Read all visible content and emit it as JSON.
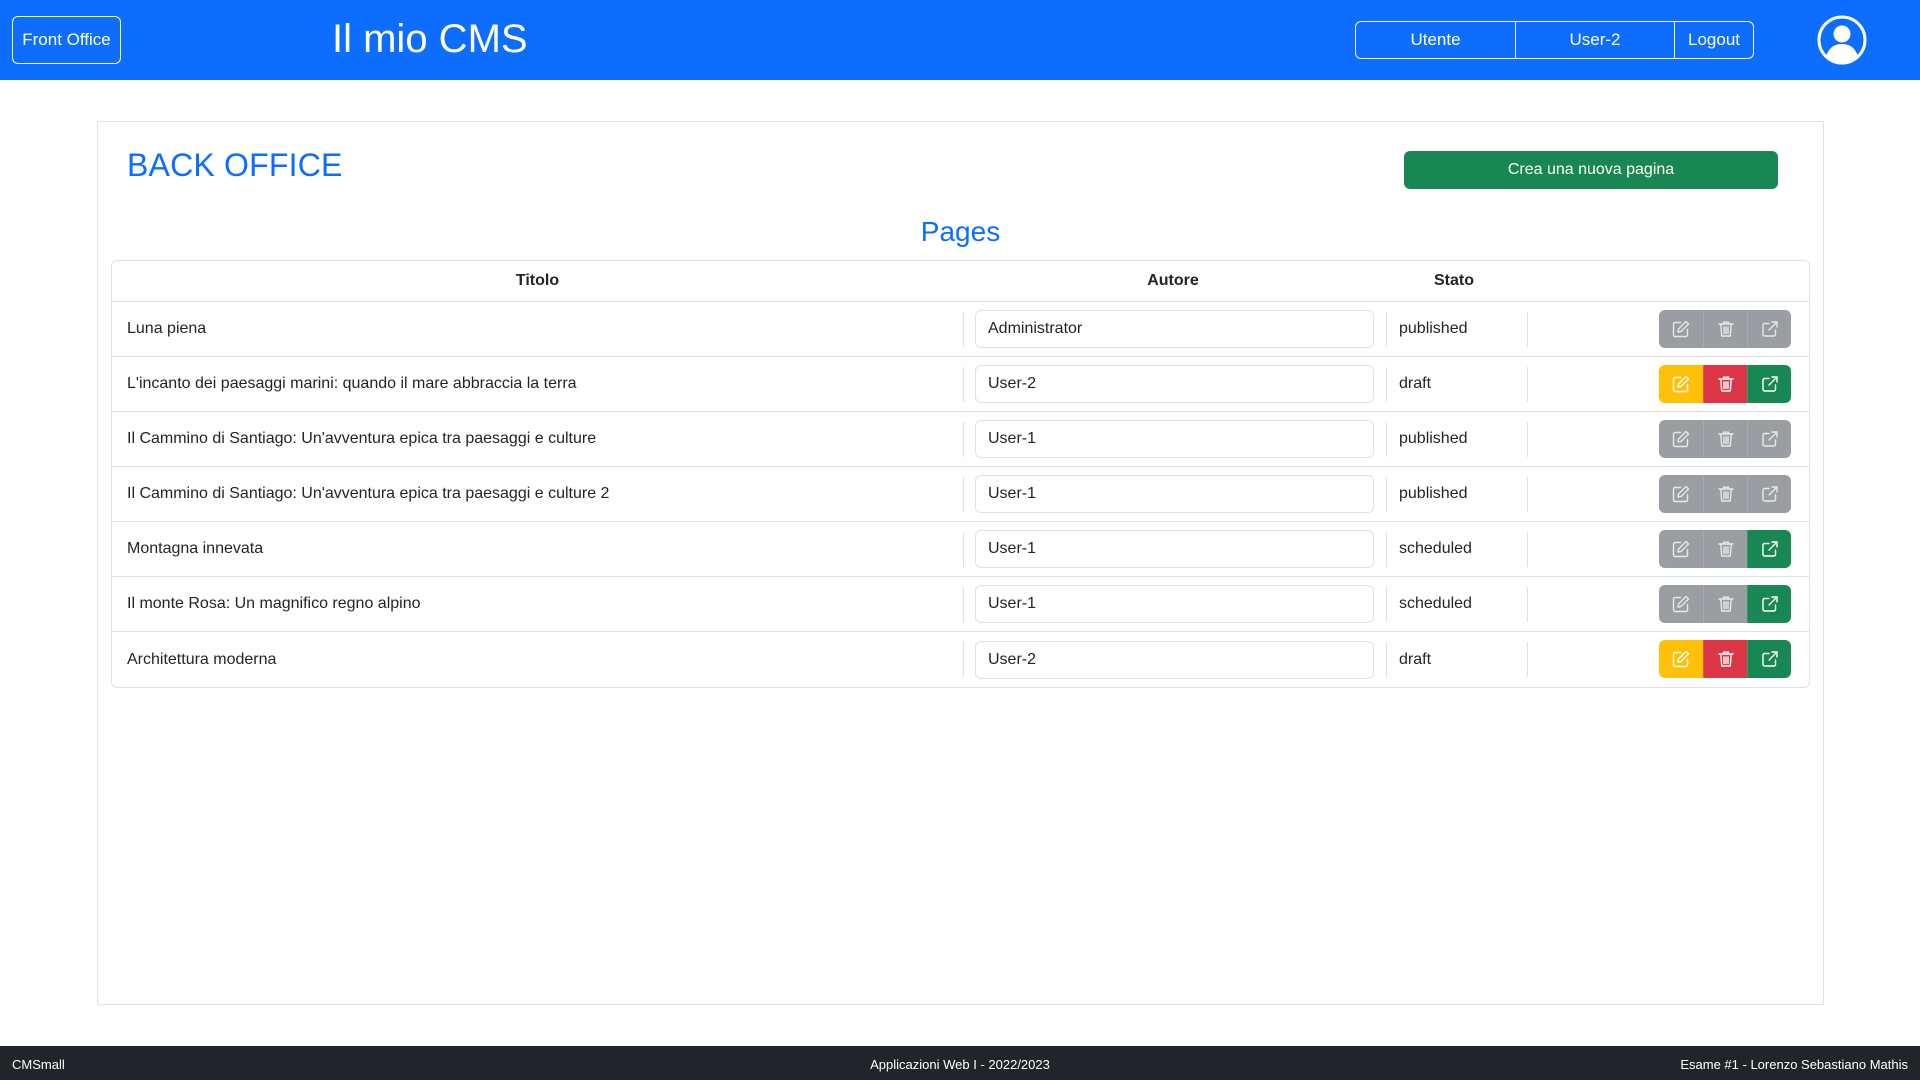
{
  "header": {
    "front_office_label": "Front Office",
    "brand": "Il mio CMS",
    "nav": {
      "user_label": "Utente",
      "username": "User-2",
      "logout_label": "Logout"
    },
    "avatar_icon": "person-circle-icon"
  },
  "main": {
    "title": "BACK OFFICE",
    "create_button": "Crea una nuova pagina",
    "table_title": "Pages",
    "columns": {
      "title": "Titolo",
      "author": "Autore",
      "state": "Stato"
    },
    "rows": [
      {
        "title": "Luna piena",
        "author": "Administrator",
        "state": "published",
        "actions_enabled": false,
        "open_enabled": false
      },
      {
        "title": "L'incanto dei paesaggi marini: quando il mare abbraccia la terra",
        "author": "User-2",
        "state": "draft",
        "actions_enabled": true,
        "open_enabled": true
      },
      {
        "title": "Il Cammino di Santiago: Un'avventura epica tra paesaggi e culture",
        "author": "User-1",
        "state": "published",
        "actions_enabled": false,
        "open_enabled": false
      },
      {
        "title": "Il Cammino di Santiago: Un'avventura epica tra paesaggi e culture 2",
        "author": "User-1",
        "state": "published",
        "actions_enabled": false,
        "open_enabled": false
      },
      {
        "title": "Montagna innevata",
        "author": "User-1",
        "state": "scheduled",
        "actions_enabled": false,
        "open_enabled": true
      },
      {
        "title": "Il monte Rosa: Un magnifico regno alpino",
        "author": "User-1",
        "state": "scheduled",
        "actions_enabled": false,
        "open_enabled": true
      },
      {
        "title": "Architettura moderna",
        "author": "User-2",
        "state": "draft",
        "actions_enabled": true,
        "open_enabled": true
      }
    ],
    "action_icons": [
      "edit-icon",
      "trash-icon",
      "external-link-icon"
    ]
  },
  "colors": {
    "primary": "#0d6efd",
    "success": "#198754",
    "warning": "#ffc107",
    "danger": "#dc3545",
    "disabled": "#9a9da1",
    "footer": "#212529"
  },
  "footer": {
    "left": "CMSmall",
    "center": "Applicazioni Web I - 2022/2023",
    "right": "Esame #1 - Lorenzo Sebastiano Mathis"
  }
}
